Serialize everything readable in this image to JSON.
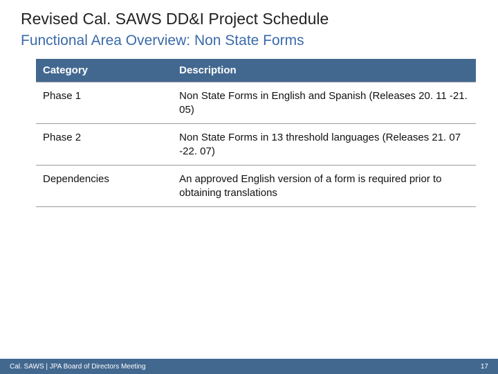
{
  "title": "Revised Cal. SAWS DD&I Project Schedule",
  "subtitle": "Functional Area Overview: Non State Forms",
  "table": {
    "headers": {
      "category": "Category",
      "description": "Description"
    },
    "rows": [
      {
        "category": "Phase 1",
        "description": "Non State Forms in English and Spanish (Releases 20. 11 -21. 05)"
      },
      {
        "category": "Phase 2",
        "description": "Non State Forms in 13 threshold languages (Releases 21. 07 -22. 07)"
      },
      {
        "category": "Dependencies",
        "description": "An approved English version of a form is required prior to obtaining translations"
      }
    ]
  },
  "footer": {
    "left": "Cal. SAWS | JPA Board of Directors Meeting",
    "page": "17"
  }
}
